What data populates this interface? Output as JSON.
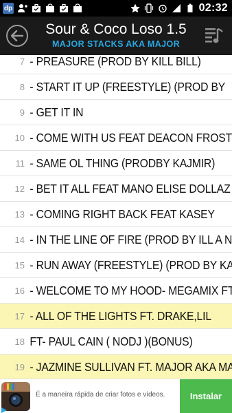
{
  "status_bar": {
    "time": "02:32",
    "app_icon_label": "dp",
    "icons": [
      "dp-app-icon",
      "person-add-icon",
      "briefcase-icon",
      "bag-icon",
      "briefcase-icon",
      "bag-icon",
      "star-icon",
      "vibrate-icon",
      "alarm-icon",
      "signal-icon",
      "battery-icon"
    ]
  },
  "header": {
    "title": "Sour & Coco Loso 1.5",
    "subtitle": "MAJOR STACKS AKA MAJOR",
    "back_icon": "back-arrow-icon",
    "playlist_icon": "playlist-music-icon",
    "subtitle_color": "#29a8e3"
  },
  "tracks": [
    {
      "num": "7",
      "name": "- PREASURE  (PROD BY KILL BILL)",
      "highlight": false
    },
    {
      "num": "8",
      "name": "- START IT UP (FREESTYLE)  (PROD BY",
      "highlight": false
    },
    {
      "num": "9",
      "name": "- GET IT IN",
      "highlight": false
    },
    {
      "num": "10",
      "name": "- COME WITH US FEAT DEACON FROST",
      "highlight": false
    },
    {
      "num": "11",
      "name": "- SAME OL THING  (PRODBY KAJMIR)",
      "highlight": false
    },
    {
      "num": "12",
      "name": "- BET IT ALL FEAT MANO  ELISE DOLLAZ",
      "highlight": false
    },
    {
      "num": "13",
      "name": "- COMING RIGHT BACK FEAT KASEY",
      "highlight": false
    },
    {
      "num": "14",
      "name": "- IN THE LINE OF FIRE  (PROD BY ILL A NOIZ)",
      "highlight": false
    },
    {
      "num": "15",
      "name": "- RUN AWAY (FREESTYLE)  (PROD BY KANYE",
      "highlight": false
    },
    {
      "num": "16",
      "name": " - WELCOME TO MY HOOD- MEGAMIX FT. JADA",
      "highlight": false
    },
    {
      "num": "17",
      "name": " - ALL OF THE LIGHTS FT. DRAKE,LIL",
      "highlight": true
    },
    {
      "num": "18",
      "name": "  FT- PAUL CAIN ( NODJ )(BONUS)",
      "highlight": false
    },
    {
      "num": "19",
      "name": " - JAZMINE SULLIVAN FT. MAJOR AKA MAJOR",
      "highlight": true
    }
  ],
  "ad": {
    "text": "É a maneira rápida de criar fotos e vídeos.",
    "button_label": "Instalar",
    "icon": "instagram-icon",
    "button_color": "#4cba4c"
  },
  "colors": {
    "highlight_row": "#fbf6b4",
    "header_bg": "#1a1a1a",
    "number_gray": "#9a9a9a"
  }
}
